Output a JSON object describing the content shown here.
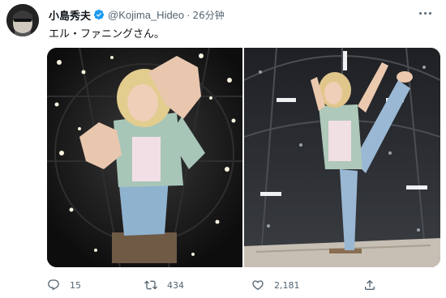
{
  "tweet": {
    "author_name": "小島秀夫",
    "handle": "@Kojima_Hideo",
    "separator": "·",
    "timestamp": "26分钟",
    "text": "エル・ファニングさん。"
  },
  "icons": {
    "verified": "verified-badge-icon",
    "more": "more-options-icon",
    "reply": "reply-icon",
    "retweet": "retweet-icon",
    "like": "like-icon",
    "share": "share-icon"
  },
  "actions": {
    "reply_count": "15",
    "retweet_count": "434",
    "like_count": "2,181"
  },
  "colors": {
    "verified": "#1d9bf0",
    "muted": "#536471",
    "text": "#0f1419"
  }
}
